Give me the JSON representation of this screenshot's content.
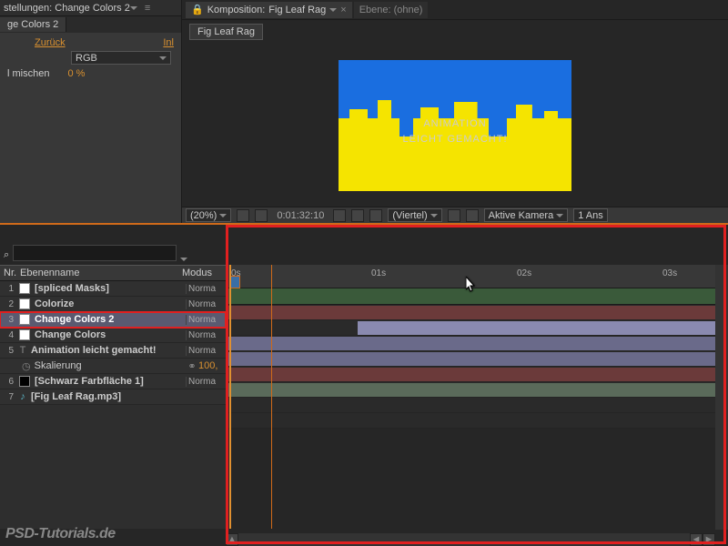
{
  "effect_panel": {
    "title": "stellungen: Change Colors 2",
    "tab": "ge Colors 2",
    "back_label": "Zurück",
    "inl_label": "Inl",
    "colorspace": "RGB",
    "mix_label": "l mischen",
    "mix_value": "0 %"
  },
  "viewer": {
    "comp_tab_prefix": "Komposition:",
    "comp_tab_name": "Fig Leaf Rag",
    "layer_tab": "Ebene: (ohne)",
    "breadcrumb": "Fig Leaf Rag",
    "preview_line1": "ANIMATION",
    "preview_line2": "LEICHT GEMACHT!",
    "footer": {
      "zoom": "(20%)",
      "timecode": "0:01:32:10",
      "quality": "(Viertel)",
      "camera": "Aktive Kamera",
      "views": "1 Ans"
    }
  },
  "timeline": {
    "search_placeholder": "",
    "search_icon": "⌕",
    "columns": {
      "nr": "Nr.",
      "name": "Ebenenname",
      "mode": "Modus"
    },
    "ruler": [
      "0s",
      "01s",
      "02s",
      "03s"
    ],
    "layers": [
      {
        "nr": "1",
        "name": "[spliced Masks]",
        "mode": "Norma",
        "swatch": "white"
      },
      {
        "nr": "2",
        "name": "Colorize",
        "mode": "Norma",
        "swatch": "white"
      },
      {
        "nr": "3",
        "name": "Change Colors 2",
        "mode": "Norma",
        "swatch": "white",
        "selected": true
      },
      {
        "nr": "4",
        "name": "Change Colors",
        "mode": "Norma",
        "swatch": "white"
      },
      {
        "nr": "5",
        "name": "Animation leicht gemacht!",
        "mode": "Norma",
        "icon": "T"
      }
    ],
    "property": {
      "name": "Skalierung",
      "value": "100,"
    },
    "layers2": [
      {
        "nr": "6",
        "name": "[Schwarz Farbfläche 1]",
        "mode": "Norma",
        "swatch": "black"
      },
      {
        "nr": "7",
        "name": "[Fig Leaf Rag.mp3]",
        "mode": "",
        "icon": "♪"
      }
    ]
  },
  "watermark": "PSD-Tutorials.de"
}
